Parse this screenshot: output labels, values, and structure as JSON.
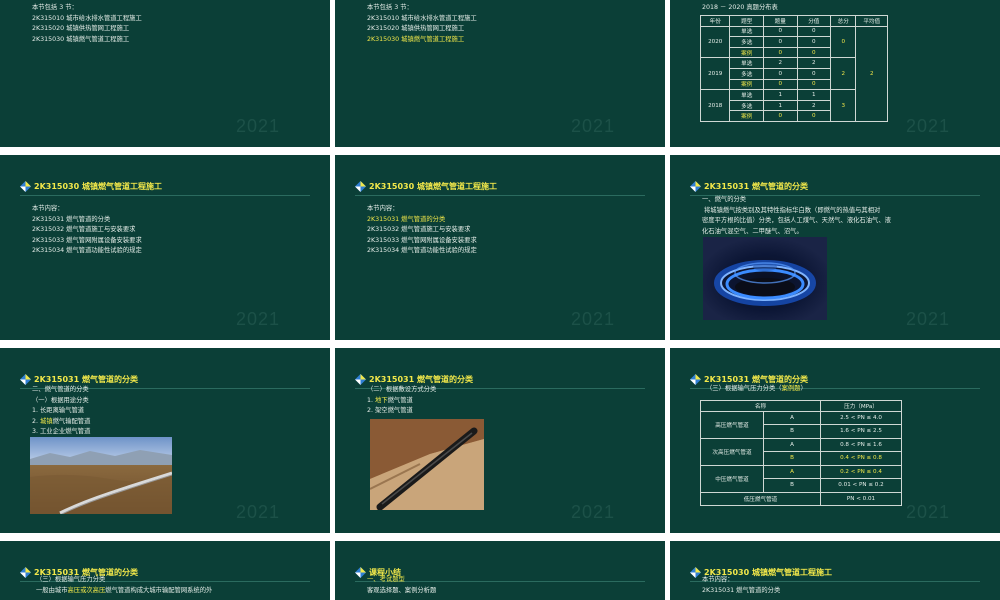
{
  "watermark": "2021",
  "s1": {
    "intro": "本节包括 3 节：",
    "items": [
      "2K315010  城市给水排水管道工程施工",
      "2K315020  城镇供热管网工程施工",
      "2K315030  城镇燃气管道工程施工"
    ]
  },
  "s2": {
    "intro": "本节包括 3 节：",
    "items": [
      "2K315010  城市给水排水管道工程施工",
      "2K315020  城镇供热管网工程施工",
      "2K315030  城镇燃气管道工程施工"
    ]
  },
  "s3": {
    "caption": "2018 － 2020 真题分布表",
    "headers": [
      "年份",
      "题型",
      "题量",
      "分值",
      "总分",
      "平均值"
    ],
    "years": [
      {
        "year": "2020",
        "total": "0",
        "rows": [
          [
            "单选",
            "0",
            "0"
          ],
          [
            "多选",
            "0",
            "0"
          ],
          [
            "案例",
            "0",
            "0"
          ]
        ]
      },
      {
        "year": "2019",
        "total": "2",
        "rows": [
          [
            "单选",
            "2",
            "2"
          ],
          [
            "多选",
            "0",
            "0"
          ],
          [
            "案例",
            "0",
            "0"
          ]
        ]
      },
      {
        "year": "2018",
        "total": "3",
        "rows": [
          [
            "单选",
            "1",
            "1"
          ],
          [
            "多选",
            "1",
            "2"
          ],
          [
            "案例",
            "0",
            "0"
          ]
        ]
      }
    ],
    "average": "2"
  },
  "s4": {
    "title": "2K315030  城镇燃气管道工程施工",
    "intro": "本节内容：",
    "items": [
      "2K315031  燃气管道的分类",
      "2K315032  燃气管道施工与安装要求",
      "2K315033  燃气管网附属设备安装要求",
      "2K315034  燃气管道功能性试验的规定"
    ]
  },
  "s5": {
    "title": "2K315030  城镇燃气管道工程施工",
    "intro": "本节内容：",
    "items": [
      "2K315031  燃气管道的分类",
      "2K315032  燃气管道施工与安装要求",
      "2K315033  燃气管网附属设备安装要求",
      "2K315034  燃气管道功能性试验的规定"
    ]
  },
  "s6": {
    "title": "2K315031  燃气管道的分类",
    "heading": "一、燃气的分类",
    "para": [
      "将城镇燃气按类别及其特性指标华白数（即燃气的热值与其相对",
      "密度平方根的比值）分类，包括人工煤气、天然气、液化石油气、液",
      "化石油气混空气、二甲醚气、沼气。"
    ]
  },
  "s7": {
    "title": "2K315031  燃气管道的分类",
    "items": [
      "二、燃气管道的分类",
      "（一）根据用途分类",
      "1. 长距离输气管道",
      "2. 城镇燃气输配管道",
      "3. 工业企业燃气管道"
    ],
    "highlight": "城镇"
  },
  "s8": {
    "title": "2K315031  燃气管道的分类",
    "items": [
      "（二）根据敷设方式分类",
      "1. 地下燃气管道",
      "2. 架空燃气管道"
    ],
    "highlight": "地下"
  },
  "s9": {
    "title": "2K315031  燃气管道的分类",
    "intro": "（三）根据输气压力分类（",
    "intro_hl": "案例题",
    "intro_end": "）",
    "headers": [
      "名称",
      "压力（MPa）"
    ],
    "groups": [
      {
        "name": "高压燃气管道",
        "rows": [
          [
            "A",
            "2.5 < PN ≤ 4.0"
          ],
          [
            "B",
            "1.6 < PN ≤ 2.5"
          ]
        ]
      },
      {
        "name": "次高压燃气管道",
        "rows": [
          [
            "A",
            "0.8 < PN ≤ 1.6"
          ],
          [
            "B",
            "0.4 < PN ≤ 0.8"
          ]
        ]
      },
      {
        "name": "中压燃气管道",
        "rows": [
          [
            "A",
            "0.2 < PN ≤ 0.4"
          ],
          [
            "B",
            "0.01 < PN ≤ 0.2"
          ]
        ]
      }
    ],
    "low_name": "低压燃气管道",
    "low_value": "PN < 0.01"
  },
  "s10": {
    "title": "2K315031  燃气管道的分类",
    "line1": "（三）根据输气压力分类",
    "line2a": "一般由城市",
    "line2b": "高压或次高压",
    "line2c": "燃气管道构成大城市输配管网系统的外"
  },
  "s11": {
    "title": "课程小结",
    "line1": "一、考试题型",
    "line2": "客观选择题、案例分析题"
  },
  "s12": {
    "title": "2K315030  城镇燃气管道工程施工",
    "intro": "本节内容：",
    "item1": "2K315031  燃气管道的分类"
  },
  "colors": {
    "slide_bg": "#0b3f37",
    "title_yellow": "#f2e84a",
    "text": "#e6eee9"
  }
}
